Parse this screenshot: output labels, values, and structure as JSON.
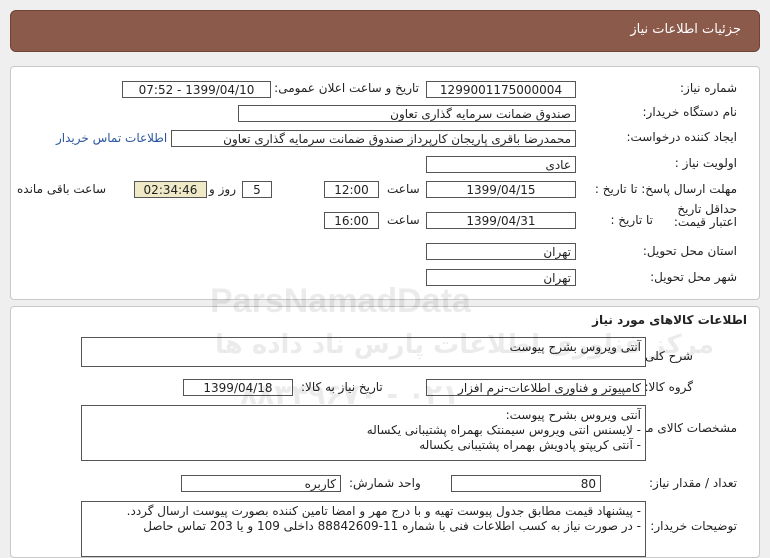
{
  "page_title": "جزئیات اطلاعات نیاز",
  "watermark": {
    "brand": "ParsNamadData",
    "line1": "مرکز فناوری اطلاعات پارس ناد داده ها",
    "line2": "۰۲۱ - ۸۸۳۴۹۶۷۰"
  },
  "general": {
    "need_number_label": "شماره نیاز:",
    "need_number": "1299001175000004",
    "announce_label": "تاریخ و ساعت اعلان عمومی:",
    "announce_value": "1399/04/10 - 07:52",
    "buyer_org_label": "نام دستگاه خریدار:",
    "buyer_org": "صندوق ضمانت سرمایه گذاری تعاون",
    "creator_label": "ایجاد کننده درخواست:",
    "creator": "محمدرضا باقری پاریجان کارپرداز صندوق ضمانت سرمایه گذاری تعاون",
    "contact_link": "اطلاعات تماس خریدار",
    "priority_label": "اولویت نیاز :",
    "priority": "عادی",
    "deadline_label": "مهلت ارسال پاسخ: تا تاریخ :",
    "deadline_date": "1399/04/15",
    "time_label": "ساعت",
    "deadline_time": "12:00",
    "days_value": "5",
    "days_label": "روز و",
    "remaining_time": "02:34:46",
    "remaining_label": "ساعت باقی مانده",
    "validity_label": "حداقل تاریخ اعتبار قیمت:",
    "validity_to_label": "تا تاریخ :",
    "validity_date": "1399/04/31",
    "validity_time": "16:00",
    "province_label": "استان محل تحویل:",
    "province": "تهران",
    "city_label": "شهر محل تحویل:",
    "city": "تهران"
  },
  "goods": {
    "section_title": "اطلاعات کالاهای مورد نیاز",
    "summary_label": "شرح کلی نیاز:",
    "summary": "آنتی ویروس بشرح پیوست",
    "group_label": "گروه کالا:",
    "group": "کامپیوتر و فناوری اطلاعات-نرم افزار",
    "need_date_label": "تاریخ نیاز به کالا:",
    "need_date": "1399/04/18",
    "specs_label": "مشخصات کالای مورد نیاز:",
    "specs": [
      "آنتی ویروس بشرح پیوست:",
      "- لایسنس انتی ویروس سیمنتک بهمراه پشتیبانی یکساله",
      "- آنتی کریپتو پادویش بهمراه پشتیبانی یکساله"
    ],
    "qty_label": "تعداد / مقدار نیاز:",
    "qty": "80",
    "unit_label": "واحد شمارش:",
    "unit": "کاربره",
    "notes_label": "توضیحات خریدار:",
    "notes": [
      "- پیشنهاد قیمت مطابق جدول پیوست تهیه و با درج مهر و امضا تامین کننده بصورت پیوست ارسال گردد.",
      "- در صورت نیاز به کسب اطلاعات فنی با شماره 11-88842609  داخلی 109 و یا 203 تماس حاصل"
    ]
  },
  "colors": {
    "header_bg": "#8b5a4a",
    "link": "#2a55a0",
    "highlight_bg": "#f0e9c8"
  }
}
